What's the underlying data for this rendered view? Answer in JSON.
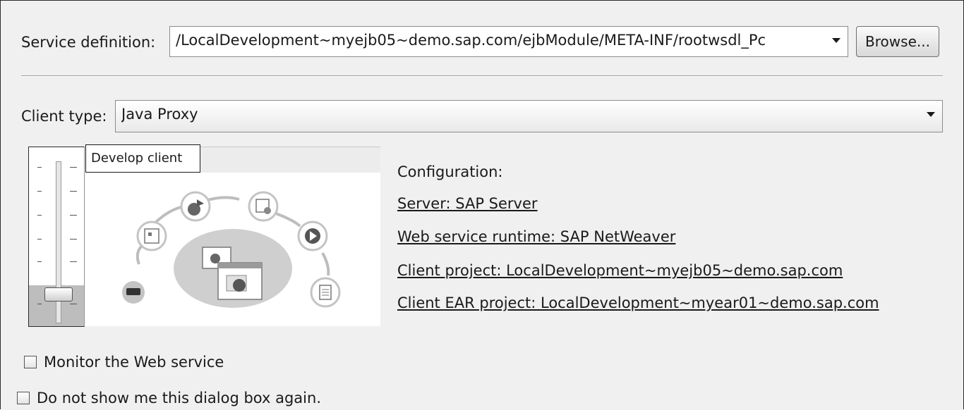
{
  "service": {
    "label": "Service definition:",
    "value": "/LocalDevelopment~myejb05~demo.sap.com/ejbModule/META-INF/rootwsdl_Pc",
    "browse_label": "Browse..."
  },
  "client": {
    "label": "Client type:",
    "value": "Java Proxy"
  },
  "slider": {
    "tooltip": "Develop client",
    "level_from_top": 0.85
  },
  "configuration": {
    "heading": "Configuration:",
    "links": [
      "Server: SAP Server",
      "Web service runtime: SAP NetWeaver",
      "Client project: LocalDevelopment~myejb05~demo.sap.com",
      "Client EAR project: LocalDevelopment~myear01~demo.sap.com"
    ]
  },
  "options": {
    "monitor_label": "Monitor the Web service",
    "monitor_checked": false,
    "dont_show_label": "Do not show me this dialog box again.",
    "dont_show_checked": false
  }
}
